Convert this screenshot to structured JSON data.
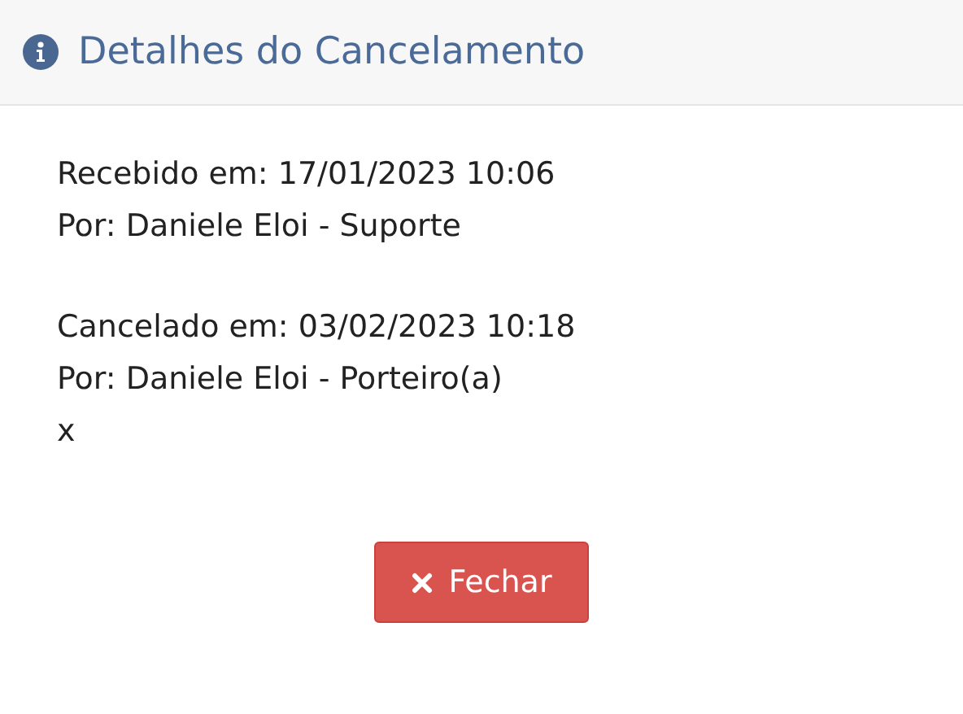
{
  "dialog": {
    "title": "Detalhes do Cancelamento",
    "sections": [
      {
        "lines": [
          "Recebido em: 17/01/2023 10:06",
          "Por: Daniele Eloi - Suporte"
        ]
      },
      {
        "lines": [
          "Cancelado em: 03/02/2023 10:18",
          "Por: Daniele Eloi - Porteiro(a)",
          "x"
        ]
      }
    ],
    "buttons": [
      {
        "label": "Fechar",
        "kind": "close"
      }
    ]
  }
}
